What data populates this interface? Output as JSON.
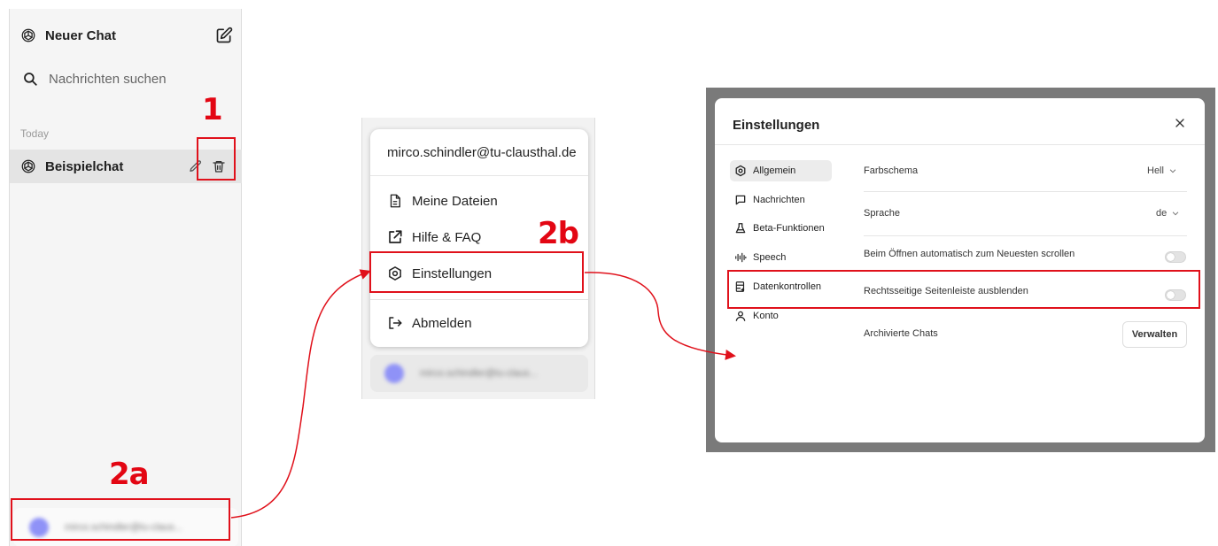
{
  "sidebar": {
    "new_chat_label": "Neuer Chat",
    "search_label": "Nachrichten suchen",
    "section_label": "Today",
    "chat_item_label": "Beispielchat",
    "user_blurred_text": "mirco.schindler@tu-claus..."
  },
  "user_menu": {
    "email": "mirco.schindler@tu-clausthal.de",
    "items": [
      {
        "label": "Meine Dateien",
        "icon": "file-icon"
      },
      {
        "label": "Hilfe & FAQ",
        "icon": "external-link-icon"
      },
      {
        "label": "Einstellungen",
        "icon": "settings-icon"
      },
      {
        "label": "Abmelden",
        "icon": "logout-icon"
      }
    ],
    "user_blurred_text": "mirco.schindler@tu-claus..."
  },
  "settings": {
    "title": "Einstellungen",
    "nav": [
      {
        "label": "Allgemein",
        "icon": "settings-icon",
        "active": true
      },
      {
        "label": "Nachrichten",
        "icon": "message-icon"
      },
      {
        "label": "Beta-Funktionen",
        "icon": "flask-icon"
      },
      {
        "label": "Speech",
        "icon": "waveform-icon"
      },
      {
        "label": "Datenkontrollen",
        "icon": "database-icon"
      },
      {
        "label": "Konto",
        "icon": "user-icon"
      }
    ],
    "rows": {
      "color_scheme_label": "Farbschema",
      "color_scheme_value": "Hell",
      "language_label": "Sprache",
      "language_value": "de",
      "autoscroll_label": "Beim Öffnen automatisch zum Neuesten scrollen",
      "autoscroll_on": false,
      "hide_sidebar_label": "Rechtsseitige Seitenleiste ausblenden",
      "hide_sidebar_on": false,
      "archived_label": "Archivierte Chats",
      "manage_button": "Verwalten"
    }
  },
  "annotations": {
    "step1": "1",
    "step2a": "2a",
    "step2b": "2b",
    "color": "#e0111b"
  }
}
